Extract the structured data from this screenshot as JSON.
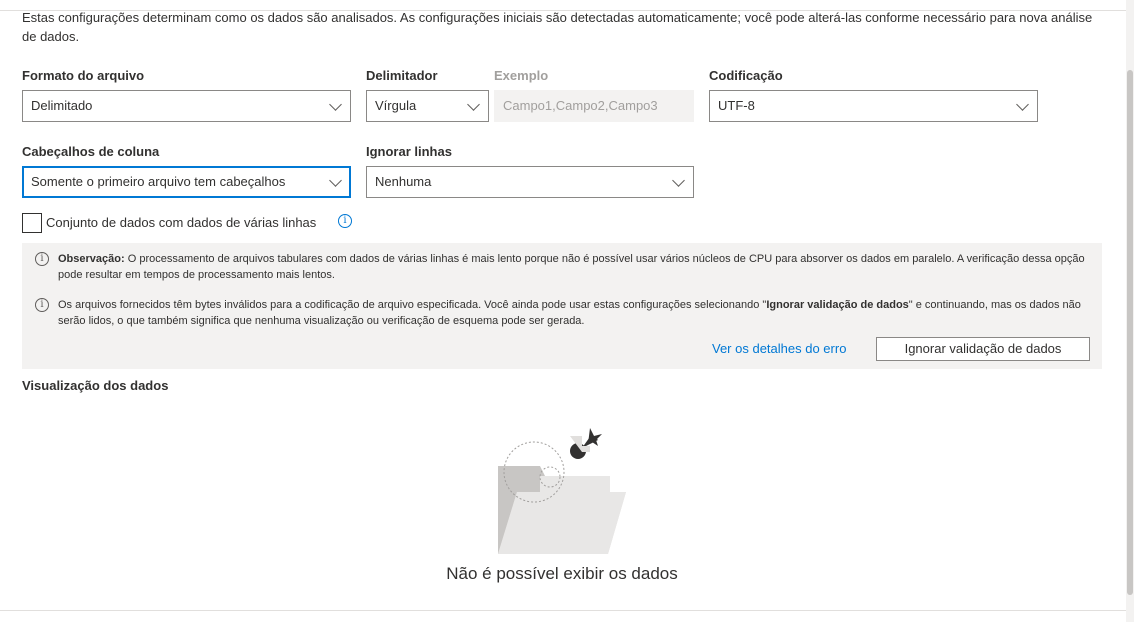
{
  "intro": "Estas configurações determinam como os dados são analisados. As configurações iniciais são detectadas automaticamente; você pode alterá-las conforme necessário para nova análise de dados.",
  "fields": {
    "file_format": {
      "label": "Formato do arquivo",
      "value": "Delimitado"
    },
    "delimiter": {
      "label": "Delimitador",
      "value": "Vírgula"
    },
    "example": {
      "label": "Exemplo",
      "value": "Campo1,Campo2,Campo3"
    },
    "encoding": {
      "label": "Codificação",
      "value": "UTF-8"
    },
    "column_headers": {
      "label": "Cabeçalhos de coluna",
      "value": "Somente o primeiro arquivo tem cabeçalhos"
    },
    "skip_rows": {
      "label": "Ignorar linhas",
      "value": "Nenhuma"
    }
  },
  "multiline": {
    "label": "Conjunto de dados com dados de várias linhas",
    "checked": false
  },
  "notice": {
    "note1_prefix": "Observação:",
    "note1_text": " O processamento de arquivos tabulares com dados de várias linhas é mais lento porque não é possível usar vários núcleos de CPU para absorver os dados em paralelo. A verificação dessa opção pode resultar em tempos de processamento mais lentos.",
    "note2_part1": "Os arquivos fornecidos têm bytes inválidos para a codificação de arquivo especificada. Você ainda pode usar estas configurações selecionando \"",
    "note2_bold": "Ignorar validação de dados",
    "note2_part2": "\" e continuando, mas os dados não serão lidos, o que também significa que nenhuma visualização ou verificação de esquema pode ser gerada.",
    "error_details_link": "Ver os detalhes do erro",
    "skip_validation_button": "Ignorar validação de dados"
  },
  "preview": {
    "title": "Visualização dos dados",
    "empty_message": "Não é possível exibir os dados"
  },
  "colors": {
    "accent": "#0078d4",
    "notice_bg": "#f3f2f1",
    "border": "#8a8886"
  }
}
